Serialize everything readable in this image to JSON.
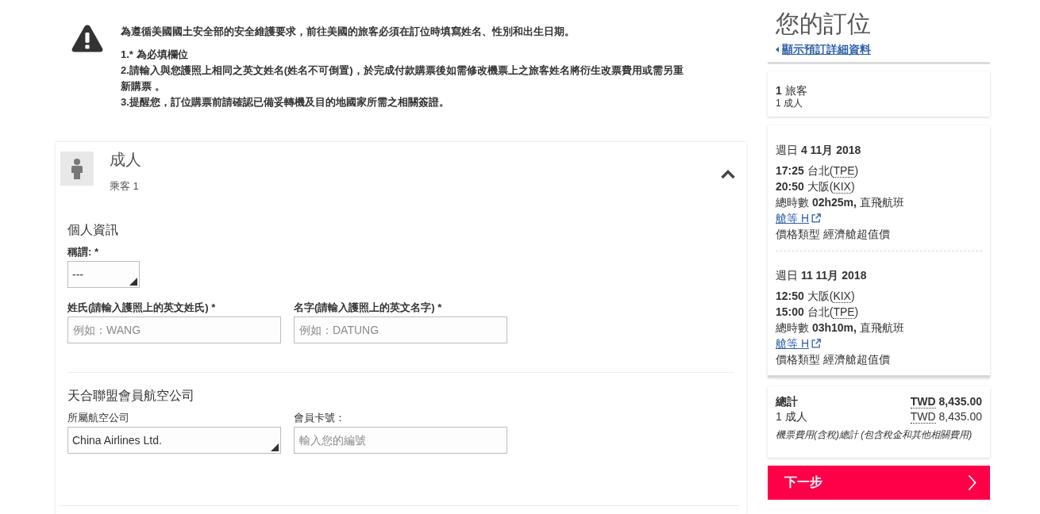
{
  "notice": {
    "lead": "為遵循美國國土安全部的安全維護要求，前往美國的旅客必須在訂位時填寫姓名、性別和出生日期。",
    "items": [
      "1.* 為必填欄位",
      "2.請輸入與您護照上相同之英文姓名(姓名不可倒置)，於完成付款購票後如需修改機票上之旅客姓名將衍生改票費用或需另重新購票 。",
      "3.提醒您，訂位購票前請確認已備妥轉機及目的地國家所需之相關簽證。"
    ]
  },
  "passenger": {
    "title": "成人",
    "subtitle": "乘客 1",
    "expanded": true,
    "sections": [
      {
        "title": "個人資訊",
        "rows": [
          [
            {
              "kind": "select",
              "label": "稱謂: *",
              "required": true,
              "value": "---"
            }
          ],
          [
            {
              "kind": "text",
              "label": "姓氏(請輸入護照上的英文姓氏) *",
              "required": true,
              "placeholder": "例如：WANG"
            },
            {
              "kind": "text",
              "label": "名字(請輸入護照上的英文名字) *",
              "required": true,
              "placeholder": "例如：DATUNG"
            }
          ]
        ]
      },
      {
        "title": "天合聯盟會員航空公司",
        "rows": [
          [
            {
              "kind": "select",
              "label": "所屬航空公司",
              "required": false,
              "value": "China Airlines Ltd."
            },
            {
              "kind": "text",
              "label": "會員卡號：",
              "required": false,
              "placeholder": "輸入您的編號"
            }
          ]
        ]
      }
    ]
  },
  "booking": {
    "title": "您的訂位",
    "details_link": "顯示預訂詳細資料",
    "travellers": {
      "total": "**1** 旅客",
      "breakdown": "1 成人"
    },
    "flights": [
      {
        "date": "週日 **4 11月 2018**",
        "stops": [
          {
            "time": "17:25",
            "place_before": "台北(",
            "code": "TPE",
            "place_after": ")"
          },
          {
            "time": "20:50",
            "place_before": "大阪(",
            "code": "KIX",
            "place_after": ")"
          }
        ],
        "duration": "總時數 **02h25m,** 直飛航班",
        "fare_class": "艙等 H",
        "fare_type": "價格類型 經濟艙超值價"
      },
      {
        "date": "週日 **11 11月 2018**",
        "stops": [
          {
            "time": "12:50",
            "place_before": "大阪(",
            "code": "KIX",
            "place_after": ")"
          },
          {
            "time": "15:00",
            "place_before": "台北(",
            "code": "TPE",
            "place_after": ")"
          }
        ],
        "duration": "總時數 **03h10m,** 直飛航班",
        "fare_class": "艙等 H",
        "fare_type": "價格類型 經濟艙超值價"
      }
    ],
    "totals": [
      {
        "kind": "total",
        "label": "總計",
        "currency": "TWD",
        "amount": "8,435.00"
      },
      {
        "kind": "item",
        "label": "1 成人",
        "currency": "TWD",
        "amount": "8,435.00"
      }
    ],
    "note": "機票費用(含稅)總計 (包含稅金和其他相關費用)",
    "next_button": "下一步"
  }
}
